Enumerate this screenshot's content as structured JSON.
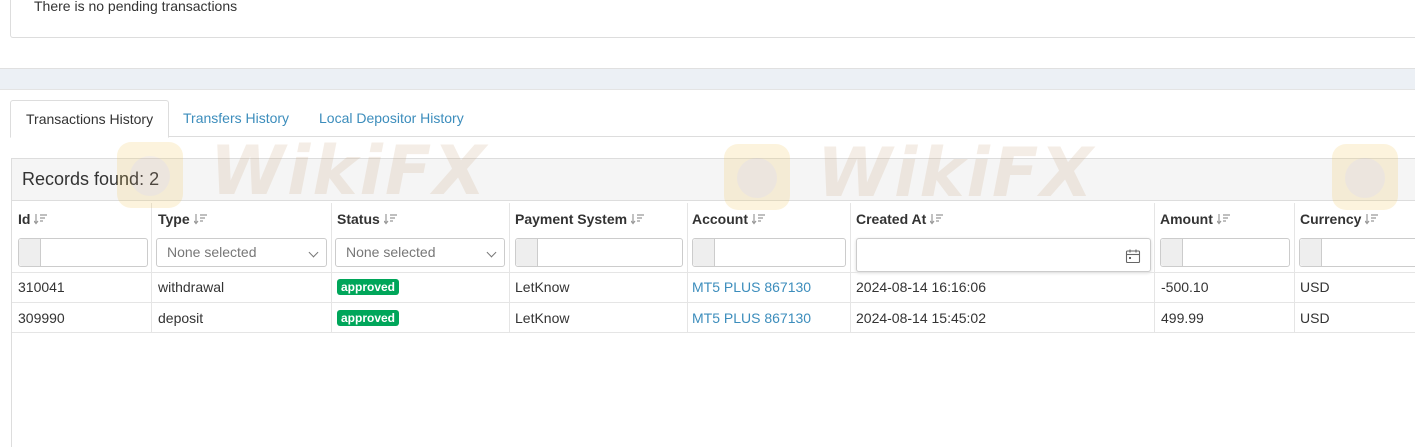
{
  "pending": {
    "message": "There is no pending transactions"
  },
  "tabs": [
    {
      "label": "Transactions History",
      "active": true
    },
    {
      "label": "Transfers History",
      "active": false
    },
    {
      "label": "Local Depositor History",
      "active": false
    }
  ],
  "records": {
    "summary": "Records found: 2"
  },
  "columns": [
    {
      "label": "Id"
    },
    {
      "label": "Type"
    },
    {
      "label": "Status"
    },
    {
      "label": "Payment System"
    },
    {
      "label": "Account"
    },
    {
      "label": "Created At"
    },
    {
      "label": "Amount"
    },
    {
      "label": "Currency"
    }
  ],
  "filters": {
    "type_placeholder": "None selected",
    "status_placeholder": "None selected"
  },
  "rows": [
    {
      "id": "310041",
      "type": "withdrawal",
      "status": "approved",
      "payment_system": "LetKnow",
      "account": "MT5 PLUS 867130",
      "created_at": "2024-08-14 16:16:06",
      "amount": "-500.10",
      "currency": "USD"
    },
    {
      "id": "309990",
      "type": "deposit",
      "status": "approved",
      "payment_system": "LetKnow",
      "account": "MT5 PLUS 867130",
      "created_at": "2024-08-14 15:45:02",
      "amount": "499.99",
      "currency": "USD"
    }
  ],
  "watermark": {
    "text": "WikiFX"
  },
  "colors": {
    "link": "#3c8dbc",
    "approved_badge": "#00a65a",
    "band": "#ecf0f5"
  }
}
